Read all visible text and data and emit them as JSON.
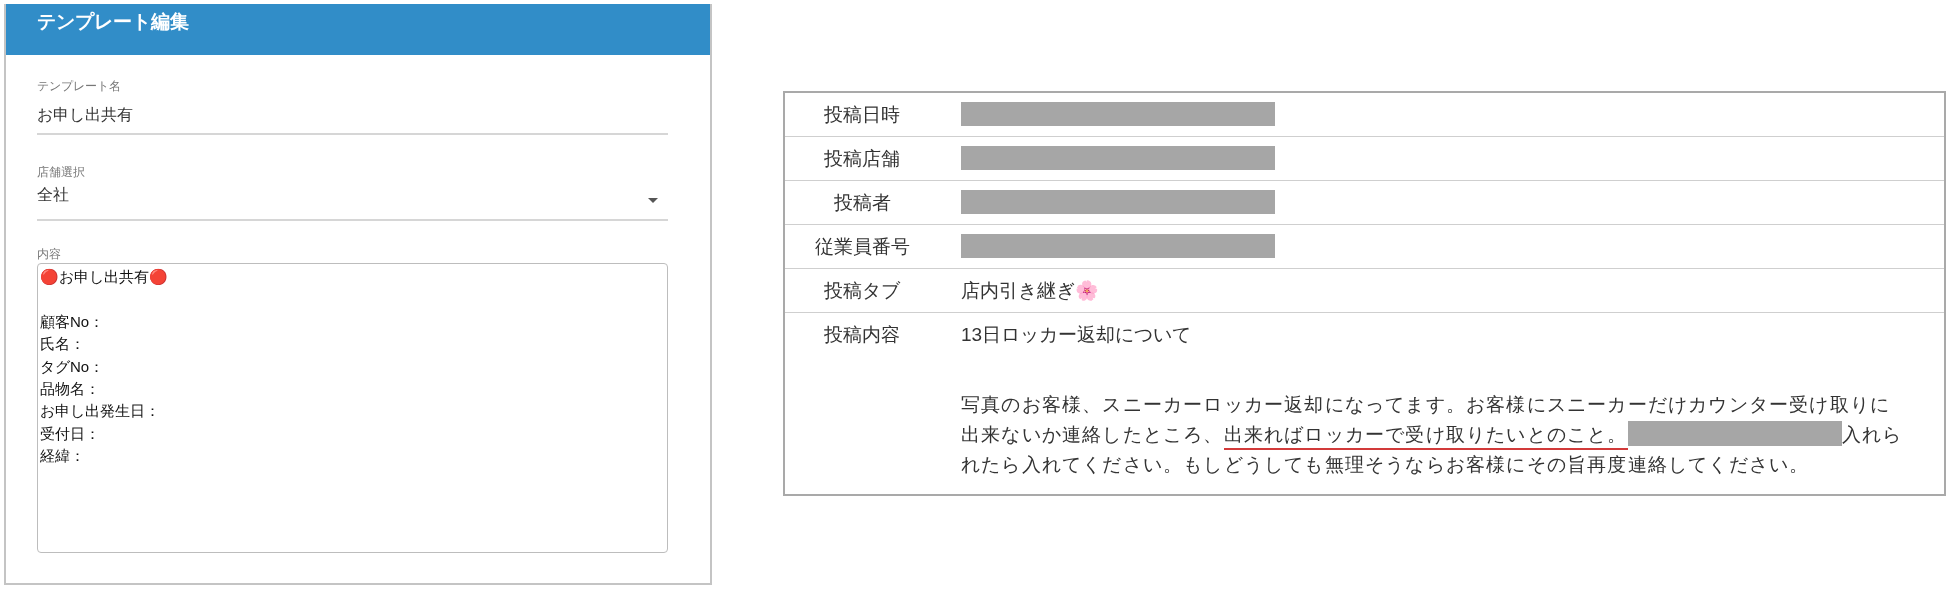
{
  "template_editor": {
    "title": "テンプレート編集",
    "fields": [
      {
        "kind": "text",
        "label": "テンプレート名",
        "value": "お申し出共有"
      },
      {
        "kind": "select",
        "label": "店舗選択",
        "value": "全社"
      },
      {
        "kind": "textarea",
        "label": "内容",
        "lines": [
          {
            "text": "🔴お申し出共有🔴",
            "gap_before": false
          },
          {
            "text": "顧客No：",
            "gap_before": true
          },
          {
            "text": "氏名：",
            "gap_before": false
          },
          {
            "text": "タグNo：",
            "gap_before": false
          },
          {
            "text": "品物名：",
            "gap_before": false
          },
          {
            "text": "お申し出発生日：",
            "gap_before": false
          },
          {
            "text": "受付日：",
            "gap_before": false
          },
          {
            "text": "経緯：",
            "gap_before": false
          }
        ]
      }
    ]
  },
  "post_details": {
    "rows": [
      {
        "label": "投稿日時",
        "redacted": true
      },
      {
        "label": "投稿店舗",
        "redacted": true
      },
      {
        "label": "投稿者",
        "redacted": true
      },
      {
        "label": "従業員番号",
        "redacted": true
      },
      {
        "label": "投稿タブ",
        "value": "店内引き継ぎ🌸"
      },
      {
        "label": "投稿内容",
        "title": "13日ロッカー返却について",
        "body": [
          {
            "kind": "text",
            "text": "写真のお客様、スニーカーロッカー返却になってます。お客様にスニーカーだけカウンター受け取りに出来ないか連絡したところ、",
            "underlined": false
          },
          {
            "kind": "text",
            "text": "出来ればロッカーで受け取りたいとのこと。",
            "underlined": true
          },
          {
            "kind": "redaction"
          },
          {
            "kind": "text",
            "text": "入れられたら入れてください。もしどうしても無理そうならお客様にその旨再度連絡してください。",
            "underlined": false
          }
        ]
      }
    ]
  }
}
